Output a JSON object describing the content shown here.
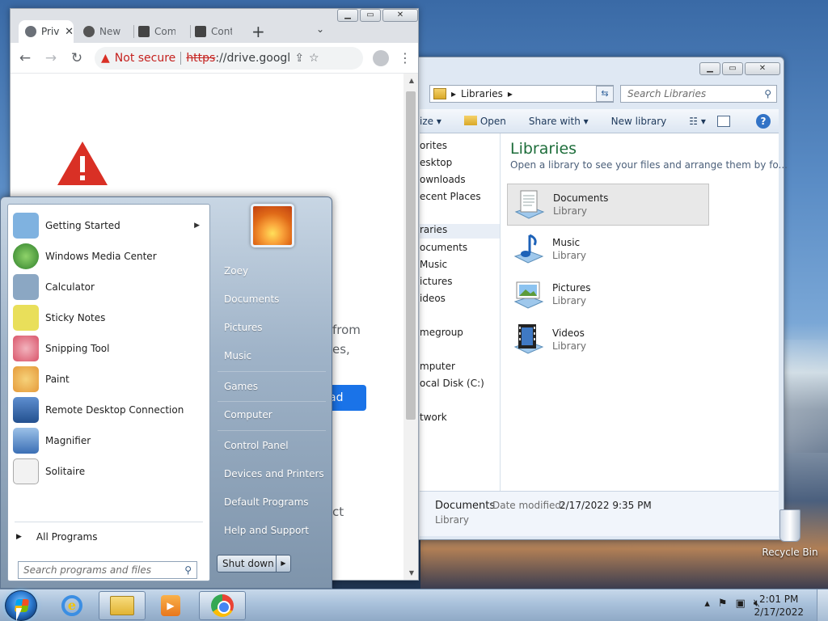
{
  "chrome": {
    "tabs": [
      {
        "label": "Privacy",
        "active": true
      },
      {
        "label": "New Tab",
        "active": false
      },
      {
        "label": "Computer",
        "active": false
      },
      {
        "label": "Content",
        "active": false
      }
    ],
    "tab_close": "✕",
    "new_tab": "+",
    "tab_search": "⌄",
    "not_secure": "Not secure",
    "url_scheme": "https",
    "url_rest": "://drive.googl...",
    "page_fragments": {
      "from": "from",
      "es": "es,",
      "ad": "ad",
      "ct": "ct"
    }
  },
  "explorer": {
    "breadcrumb": "Libraries",
    "search_placeholder": "Search Libraries",
    "cmdbar": {
      "organize": "ize",
      "open": "Open",
      "share": "Share with",
      "new_library": "New library",
      "help": "?"
    },
    "nav": [
      {
        "label": "orites",
        "selected": false
      },
      {
        "label": "esktop",
        "selected": false
      },
      {
        "label": "ownloads",
        "selected": false
      },
      {
        "label": "ecent Places",
        "selected": false
      },
      {
        "label": "raries",
        "selected": true
      },
      {
        "label": "ocuments",
        "selected": false
      },
      {
        "label": "Music",
        "selected": false
      },
      {
        "label": "ictures",
        "selected": false
      },
      {
        "label": "ideos",
        "selected": false
      },
      {
        "label": "megroup",
        "selected": false
      },
      {
        "label": "mputer",
        "selected": false
      },
      {
        "label": "ocal Disk (C:)",
        "selected": false
      },
      {
        "label": "twork",
        "selected": false
      }
    ],
    "title": "Libraries",
    "subtitle": "Open a library to see your files and arrange them by fo...",
    "libraries": [
      {
        "name": "Documents",
        "kind": "Library",
        "icon": "documents-library-icon",
        "selected": true
      },
      {
        "name": "Music",
        "kind": "Library",
        "icon": "music-library-icon",
        "selected": false
      },
      {
        "name": "Pictures",
        "kind": "Library",
        "icon": "pictures-library-icon",
        "selected": false
      },
      {
        "name": "Videos",
        "kind": "Library",
        "icon": "videos-library-icon",
        "selected": false
      }
    ],
    "details": {
      "name": "Documents",
      "kind": "Library",
      "modified_label": "Date modified:",
      "modified_value": "2/17/2022 9:35 PM"
    }
  },
  "desktop": {
    "recycle_bin": "Recycle Bin"
  },
  "start_menu": {
    "programs": [
      {
        "label": "Getting Started",
        "icon": "getting-started-icon",
        "color": "#7fb2e0",
        "submenu": true
      },
      {
        "label": "Windows Media Center",
        "icon": "media-center-icon",
        "color": "#3f9a3a",
        "submenu": false
      },
      {
        "label": "Calculator",
        "icon": "calculator-icon",
        "color": "#8ba7c3",
        "submenu": false
      },
      {
        "label": "Sticky Notes",
        "icon": "sticky-notes-icon",
        "color": "#e9df5a",
        "submenu": false
      },
      {
        "label": "Snipping Tool",
        "icon": "snipping-tool-icon",
        "color": "#d9546a",
        "submenu": false
      },
      {
        "label": "Paint",
        "icon": "paint-icon",
        "color": "#e59a3a",
        "submenu": false
      },
      {
        "label": "Remote Desktop Connection",
        "icon": "remote-desktop-icon",
        "color": "#3b6fb5",
        "submenu": false
      },
      {
        "label": "Magnifier",
        "icon": "magnifier-icon",
        "color": "#5e8fc4",
        "submenu": false
      },
      {
        "label": "Solitaire",
        "icon": "solitaire-icon",
        "color": "#c9c9c9",
        "submenu": false
      }
    ],
    "all_programs": "All Programs",
    "search_placeholder": "Search programs and files",
    "right": [
      {
        "label": "Zoey"
      },
      {
        "label": "Documents"
      },
      {
        "label": "Pictures"
      },
      {
        "label": "Music"
      },
      {
        "label": "Games"
      },
      {
        "label": "Computer"
      },
      {
        "label": "Control Panel"
      },
      {
        "label": "Devices and Printers"
      },
      {
        "label": "Default Programs"
      },
      {
        "label": "Help and Support"
      }
    ],
    "shutdown": "Shut down"
  },
  "taskbar": {
    "time": "2:01 PM",
    "date": "2/17/2022",
    "items": [
      "internet-explorer",
      "windows-explorer",
      "windows-media-player",
      "google-chrome"
    ]
  }
}
